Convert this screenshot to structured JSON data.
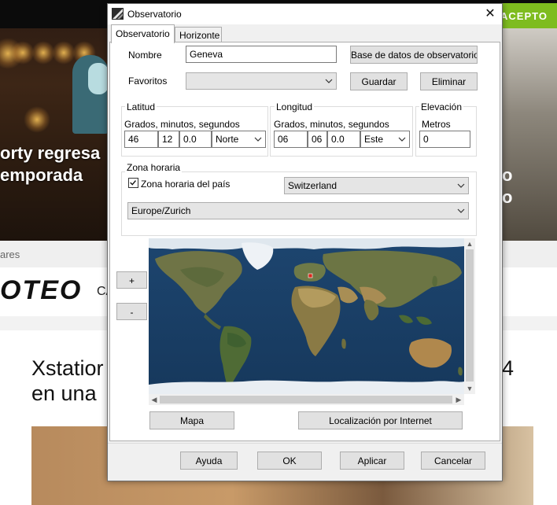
{
  "background_page": {
    "accept_label": "ACEPTO",
    "hero_line1": "orty regresa",
    "hero_line2": "emporada",
    "hero_right1": "o",
    "hero_right2": "o",
    "crumb": "ares",
    "logo": "OTEO",
    "logo_side": "CA",
    "article_title_line1": "Xstatior",
    "article_title_line2": "en una",
    "article_title_right": "4"
  },
  "window": {
    "title": "Observatorio",
    "close_glyph": "✕"
  },
  "tabs": [
    {
      "label": "Observatorio",
      "active": true
    },
    {
      "label": "Horizonte",
      "active": false
    }
  ],
  "location": {
    "name_label": "Nombre",
    "name_value": "Geneva",
    "database_button": "Base de datos de observatorios",
    "favorites_label": "Favoritos",
    "favorites_value": "",
    "save_button": "Guardar",
    "delete_button": "Eliminar"
  },
  "latitude": {
    "group_title": "Latitud",
    "sublabel": "Grados, minutos, segundos",
    "degrees": "46",
    "minutes": "12",
    "seconds": "0.0",
    "hemisphere": "Norte"
  },
  "longitude": {
    "group_title": "Longitud",
    "sublabel": "Grados, minutos, segundos",
    "degrees": "06",
    "minutes": "06",
    "seconds": "0.0",
    "hemisphere": "Este"
  },
  "elevation": {
    "group_title": "Elevación",
    "sublabel": "Metros",
    "value": "0"
  },
  "timezone": {
    "group_title": "Zona horaria",
    "country_tz_label": "Zona horaria del país",
    "country_tz_checked": true,
    "country": "Switzerland",
    "zone": "Europe/Zurich"
  },
  "map_controls": {
    "zoom_in": "+",
    "zoom_out": "-",
    "map_button": "Mapa",
    "internet_button": "Localización por Internet"
  },
  "footer": {
    "help_button": "Ayuda",
    "ok_button": "OK",
    "apply_button": "Aplicar",
    "cancel_button": "Cancelar"
  },
  "colors": {
    "accept_green": "#7ebc1f",
    "ocean": "#1a3b63",
    "land": "#7a7a48"
  },
  "icons": {
    "title": "stellarium-app-icon",
    "dropdown": "chevron-down-icon",
    "location_marker": "map-location-marker-icon"
  }
}
